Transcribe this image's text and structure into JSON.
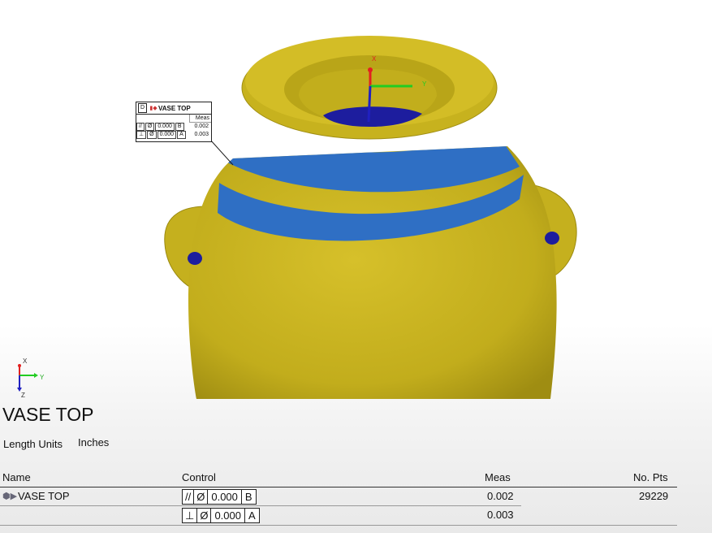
{
  "viewport": {
    "axis_labels": {
      "x": "X",
      "y": "Y",
      "z": "Z"
    },
    "colors": {
      "part": "#c9b41c",
      "band": "#2f6fc4",
      "deep": "#1d1d9e",
      "axis_x": "#e22020",
      "axis_y": "#22cc22",
      "axis_z": "#2020c0"
    }
  },
  "fcf": {
    "datum": "D",
    "icon": "vase-feature-icon",
    "title": "VASE TOP",
    "meas_header": "Meas",
    "rows": [
      {
        "symbol": "//",
        "dia": "Ø",
        "tolerance": "0.000",
        "datum": "B",
        "meas": "0.002"
      },
      {
        "symbol": "⊥",
        "dia": "Ø",
        "tolerance": "0.000",
        "datum": "A",
        "meas": "0.003"
      }
    ]
  },
  "report": {
    "title": "VASE TOP",
    "length_units_label": "Length Units",
    "length_units_value": "Inches",
    "columns": {
      "name": "Name",
      "control": "Control",
      "meas": "Meas",
      "npts": "No. Pts"
    },
    "rows": [
      {
        "name": "VASE TOP",
        "symbol": "//",
        "dia": "Ø",
        "tolerance": "0.000",
        "datum": "B",
        "meas": "0.002",
        "npts": "29229"
      },
      {
        "name": "",
        "symbol": "⊥",
        "dia": "Ø",
        "tolerance": "0.000",
        "datum": "A",
        "meas": "0.003",
        "npts": ""
      }
    ]
  }
}
